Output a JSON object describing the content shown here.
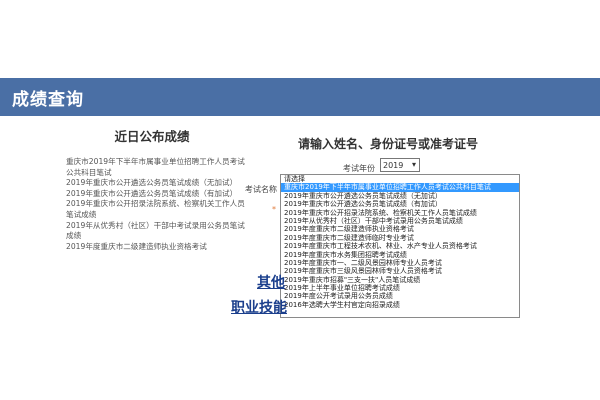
{
  "header": {
    "title": "成绩查询"
  },
  "recent": {
    "title": "近日公布成绩",
    "items": [
      "重庆市2019年下半年市属事业单位招聘工作人员考试公共科目笔试",
      "2019年重庆市公开遴选公务员笔试成绩（无加试）",
      "2019年重庆市公开遴选公务员笔试成绩（有加试）",
      "2019年重庆市公开招录法院系统、检察机关工作人员笔试成绩",
      "2019年从优秀村（社区）干部中考试录用公务员笔试成绩",
      "2019年度重庆市二级建造师执业资格考试"
    ]
  },
  "query": {
    "title": "请输入姓名、身份证号或准考证号",
    "year_label": "考试年份",
    "year_value": "2019",
    "exam_label": "考试名称",
    "required_mark": "*",
    "options": [
      "请选择",
      "重庆市2019年下半年市属事业单位招聘工作人员考试公共科目笔试",
      "2019年重庆市公开遴选公务员笔试成绩（无加试）",
      "2019年重庆市公开遴选公务员笔试成绩（有加试）",
      "2019年重庆市公开招录法院系统、检察机关工作人员笔试成绩",
      "2019年从优秀村（社区）干部中考试录用公务员笔试成绩",
      "2019年度重庆市二级建造师执业资格考试",
      "2019年度重庆市二级建造师临时专业考试",
      "2019年度重庆市工程技术农机、林业、水产专业人员资格考试",
      "2019年度重庆市水务集团招聘考试成绩",
      "2019年度重庆市一、二级风景园林师专业人员考试",
      "2019年度重庆市三级风景园林师专业人员资格考试",
      "2019年重庆市招募\"三支一扶\"人员笔试成绩",
      "2019年上半年事业单位招聘考试成绩",
      "2019年度公开考试录用公务员成绩",
      "2016年选聘大学生村官定向招录成绩"
    ],
    "selected_index": 1
  },
  "links": {
    "other": "其他",
    "career": "职业技能"
  },
  "colors": {
    "header_bg": "#4a6fa5",
    "selected_bg": "#3399ff",
    "link": "#1a3e8c",
    "required": "#e07a3a"
  }
}
